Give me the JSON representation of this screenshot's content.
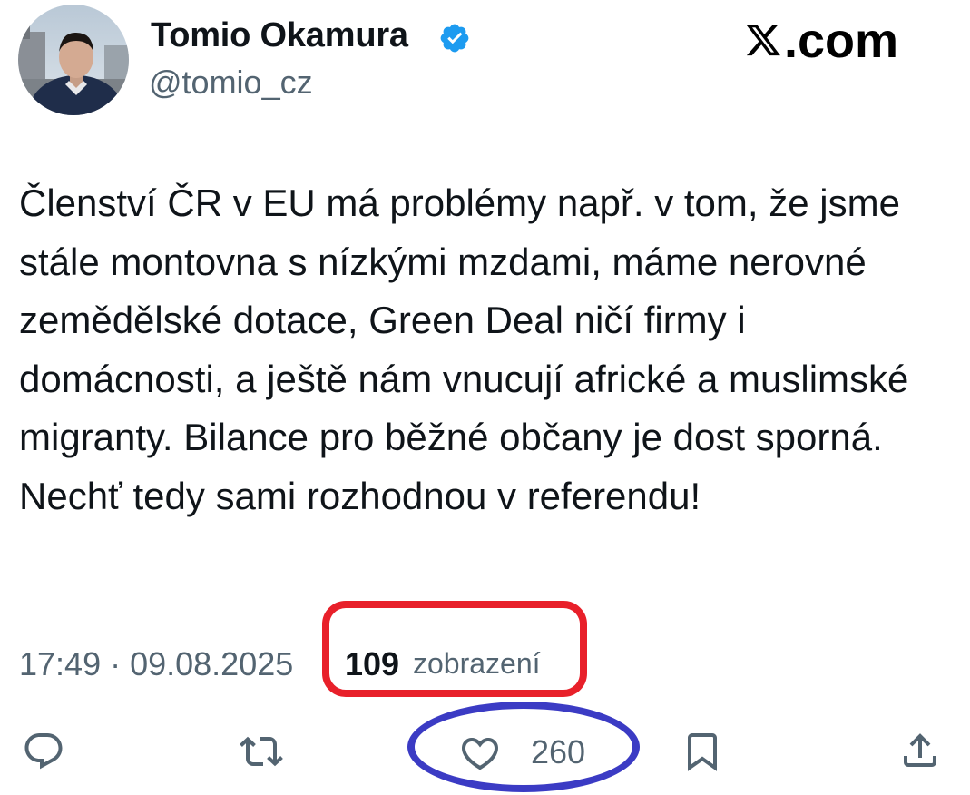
{
  "author": {
    "display_name": "Tomio Okamura",
    "handle": "@tomio_cz",
    "verified": true
  },
  "brand": {
    "logo_text": ".com",
    "logo_icon": "x-logo-icon"
  },
  "tweet": {
    "text": "Členství ČR v EU má problémy např. v tom, že jsme stále montovna s nízkými mzdami, máme nerovné zemědělské dotace, Green Deal ničí firmy i domácnosti, a ještě nám vnucují africké a muslimské migranty. Bilance pro běžné občany je dost sporná. Nechť tedy sami rozhodnou v referendu!",
    "timestamp": "17:49 · 09.08.2025",
    "views_count": "109",
    "views_label": "zobrazení"
  },
  "actions": {
    "reply_icon": "reply-icon",
    "retweet_icon": "retweet-icon",
    "like_icon": "heart-icon",
    "like_count": "260",
    "bookmark_icon": "bookmark-icon",
    "share_icon": "share-icon"
  },
  "colors": {
    "verified": "#1d9bf0",
    "secondary_text": "#536471",
    "highlight_red": "#e8202a",
    "highlight_blue": "#3b3bc4"
  }
}
